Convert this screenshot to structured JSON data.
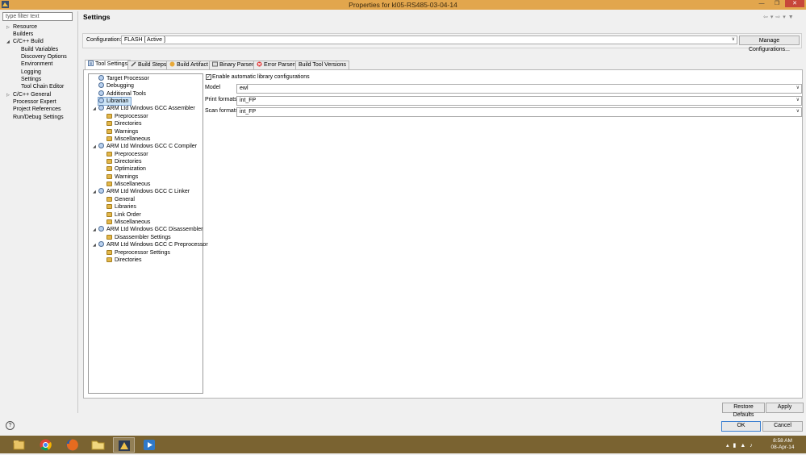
{
  "window": {
    "title": "Properties for kl05-RS485-03-04-14"
  },
  "filter": {
    "placeholder": "type filter text"
  },
  "nav": {
    "resource": "Resource",
    "builders": "Builders",
    "cbuild": "C/C++ Build",
    "build_variables": "Build Variables",
    "discovery_options": "Discovery Options",
    "environment": "Environment",
    "logging": "Logging",
    "settings": "Settings",
    "tool_chain_editor": "Tool Chain Editor",
    "cgeneral": "C/C++ General",
    "processor_expert": "Processor Expert",
    "project_references": "Project References",
    "run_debug": "Run/Debug Settings"
  },
  "page": {
    "title": "Settings",
    "config_label": "Configuration:",
    "config_value": "FLASH  [ Active ]",
    "manage_button": "Manage Configurations..."
  },
  "tabs": {
    "tool_settings": "Tool Settings",
    "build_steps": "Build Steps",
    "build_artifact": "Build Artifact",
    "binary_parsers": "Binary Parsers",
    "error_parsers": "Error Parsers",
    "build_tool_versions": "Build Tool Versions"
  },
  "tree": {
    "target_processor": "Target Processor",
    "debugging": "Debugging",
    "additional_tools": "Additional Tools",
    "librarian": "Librarian",
    "asm": "ARM Ltd Windows GCC Assembler",
    "asm_preprocessor": "Preprocessor",
    "asm_directories": "Directories",
    "asm_warnings": "Warnings",
    "asm_misc": "Miscellaneous",
    "cc": "ARM Ltd Windows GCC C Compiler",
    "cc_preprocessor": "Preprocessor",
    "cc_directories": "Directories",
    "cc_optimization": "Optimization",
    "cc_warnings": "Warnings",
    "cc_misc": "Miscellaneous",
    "ld": "ARM Ltd Windows GCC C Linker",
    "ld_general": "General",
    "ld_libraries": "Libraries",
    "ld_link_order": "Link Order",
    "ld_misc": "Miscellaneous",
    "dis": "ARM Ltd Windows GCC Disassembler",
    "dis_settings": "Disassembler Settings",
    "pp": "ARM Ltd Windows GCC C Preprocessor",
    "pp_settings": "Preprocessor Settings",
    "pp_directories": "Directories"
  },
  "options": {
    "enable_auto": "Enable automatic library configurations",
    "enable_auto_checked": true,
    "model_label": "Model",
    "model_value": "ewl",
    "print_label": "Print formats",
    "print_value": "int_FP",
    "scan_label": "Scan formats",
    "scan_value": "int_FP"
  },
  "buttons": {
    "restore_defaults": "Restore Defaults",
    "apply": "Apply",
    "ok": "OK",
    "cancel": "Cancel"
  },
  "taskbar": {
    "time": "8:58 AM",
    "date": "08-Apr-14"
  }
}
